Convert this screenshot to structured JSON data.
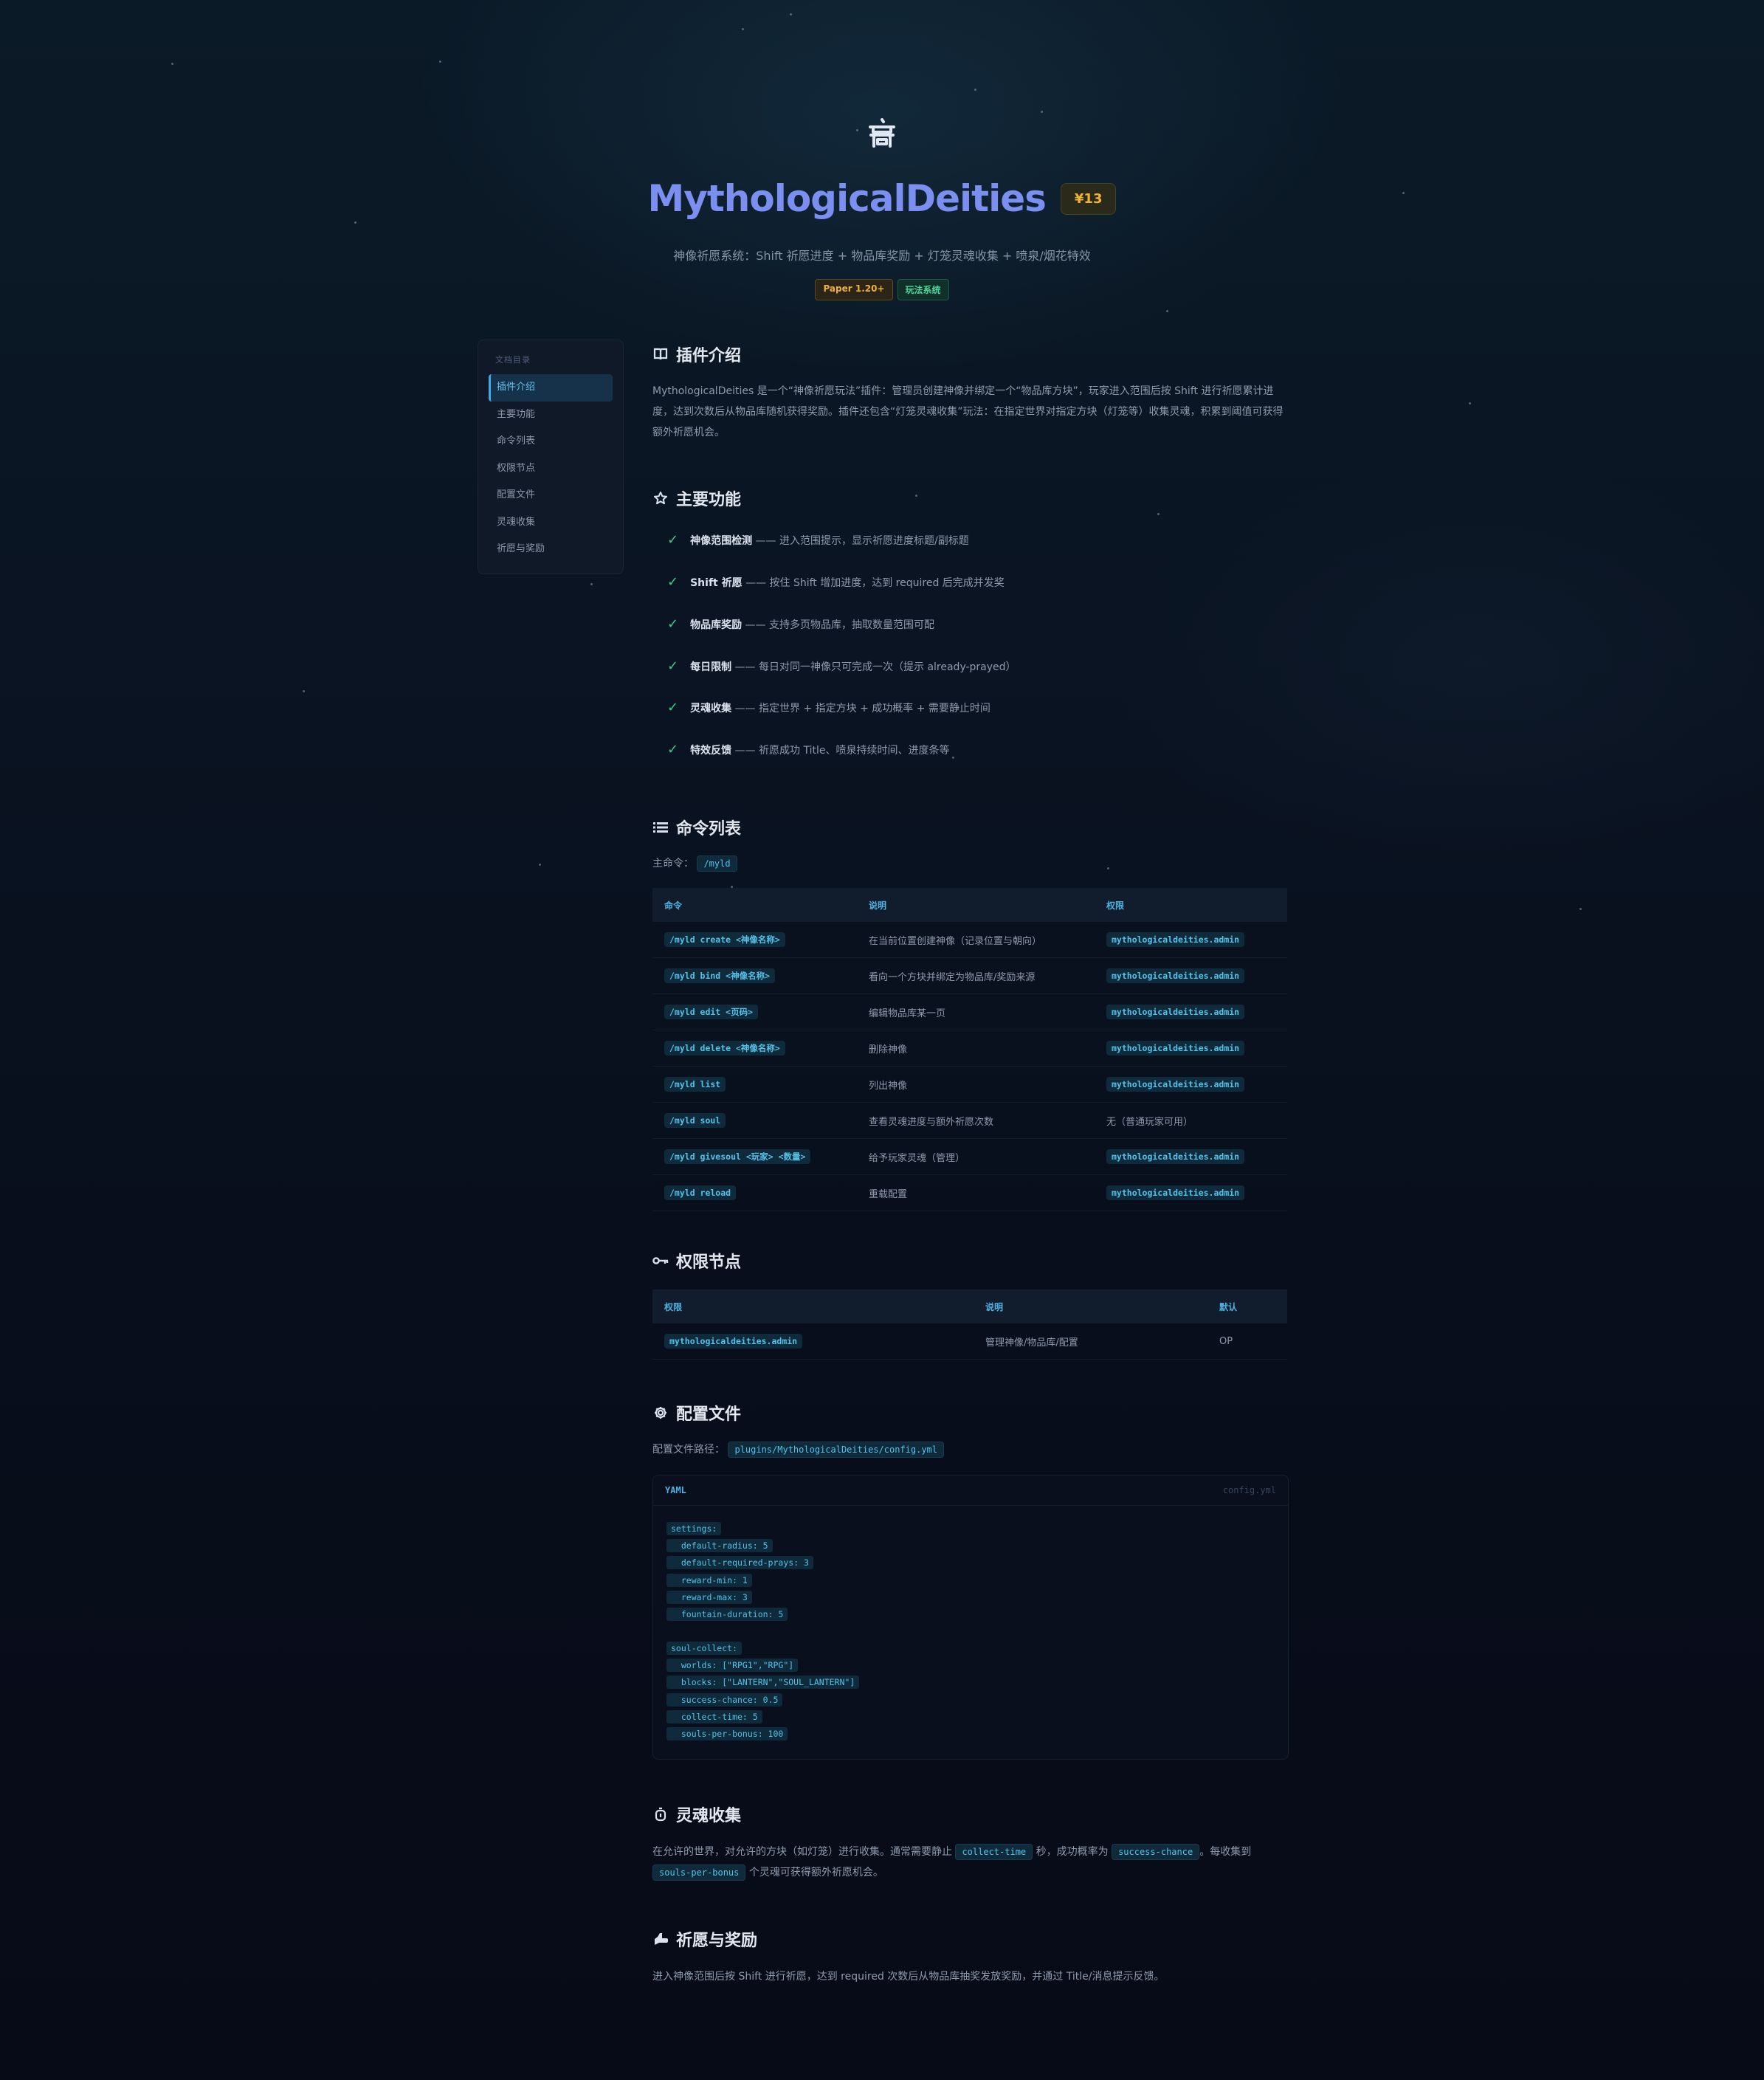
{
  "hero": {
    "icon": "temple-icon",
    "title": "MythologicalDeities",
    "price": "¥13",
    "subtitle": "神像祈愿系统：Shift 祈愿进度 + 物品库奖励 + 灯笼灵魂收集 + 喷泉/烟花特效",
    "tag_version": "Paper 1.20+",
    "tag_category": "玩法系统"
  },
  "toc": {
    "title": "文档目录",
    "items": [
      "插件介绍",
      "主要功能",
      "命令列表",
      "权限节点",
      "配置文件",
      "灵魂收集",
      "祈愿与奖励"
    ]
  },
  "intro": {
    "heading": "插件介绍",
    "text": "MythologicalDeities 是一个“神像祈愿玩法”插件：管理员创建神像并绑定一个“物品库方块”，玩家进入范围后按 Shift 进行祈愿累计进度，达到次数后从物品库随机获得奖励。插件还包含“灯笼灵魂收集”玩法：在指定世界对指定方块（灯笼等）收集灵魂，积累到阈值可获得额外祈愿机会。"
  },
  "features": {
    "heading": "主要功能",
    "items": [
      {
        "name": "神像范围检测",
        "desc": "—— 进入范围提示，显示祈愿进度标题/副标题"
      },
      {
        "name": "Shift 祈愿",
        "desc": "—— 按住 Shift 增加进度，达到 required 后完成并发奖"
      },
      {
        "name": "物品库奖励",
        "desc": "—— 支持多页物品库，抽取数量范围可配"
      },
      {
        "name": "每日限制",
        "desc": "—— 每日对同一神像只可完成一次（提示 already-prayed）"
      },
      {
        "name": "灵魂收集",
        "desc": "—— 指定世界 + 指定方块 + 成功概率 + 需要静止时间"
      },
      {
        "name": "特效反馈",
        "desc": "—— 祈愿成功 Title、喷泉持续时间、进度条等"
      }
    ]
  },
  "commands": {
    "heading": "命令列表",
    "main_label": "主命令：",
    "main_cmd": "/myld",
    "headers": [
      "命令",
      "说明",
      "权限"
    ],
    "rows": [
      {
        "cmd": "/myld create <神像名称>",
        "desc": "在当前位置创建神像（记录位置与朝向）",
        "perm": "mythologicaldeities.admin"
      },
      {
        "cmd": "/myld bind <神像名称>",
        "desc": "看向一个方块并绑定为物品库/奖励来源",
        "perm": "mythologicaldeities.admin"
      },
      {
        "cmd": "/myld edit <页码>",
        "desc": "编辑物品库某一页",
        "perm": "mythologicaldeities.admin"
      },
      {
        "cmd": "/myld delete <神像名称>",
        "desc": "删除神像",
        "perm": "mythologicaldeities.admin"
      },
      {
        "cmd": "/myld list",
        "desc": "列出神像",
        "perm": "mythologicaldeities.admin"
      },
      {
        "cmd": "/myld soul",
        "desc": "查看灵魂进度与额外祈愿次数",
        "perm": "无（普通玩家可用）"
      },
      {
        "cmd": "/myld givesoul <玩家> <数量>",
        "desc": "给予玩家灵魂（管理）",
        "perm": "mythologicaldeities.admin"
      },
      {
        "cmd": "/myld reload",
        "desc": "重载配置",
        "perm": "mythologicaldeities.admin"
      }
    ]
  },
  "permissions": {
    "heading": "权限节点",
    "headers": [
      "权限",
      "说明",
      "默认"
    ],
    "rows": [
      {
        "perm": "mythologicaldeities.admin",
        "desc": "管理神像/物品库/配置",
        "default": "OP"
      }
    ]
  },
  "config": {
    "heading": "配置文件",
    "path_label": "配置文件路径：",
    "path": "plugins/MythologicalDeities/config.yml",
    "lang": "YAML",
    "filename": "config.yml",
    "lines": [
      "settings:",
      "  default-radius: 5",
      "  default-required-prays: 3",
      "  reward-min: 1",
      "  reward-max: 3",
      "  fountain-duration: 5",
      "soul-collect:",
      "  worlds: [\"RPG1\",\"RPG\"]",
      "  blocks: [\"LANTERN\",\"SOUL_LANTERN\"]",
      "  success-chance: 0.5",
      "  collect-time: 5",
      "  souls-per-bonus: 100"
    ]
  },
  "soul": {
    "heading": "灵魂收集",
    "t1": "在允许的世界，对允许的方块（如灯笼）进行收集。通常需要静止",
    "c1": "collect-time",
    "t2": "秒，成功概率为",
    "c2": "success-chance",
    "t3": "。每收集到",
    "c3": "souls-per-bonus",
    "t4": "个灵魂可获得额外祈愿机会。"
  },
  "pray": {
    "heading": "祈愿与奖励",
    "text": "进入神像范围后按 Shift 进行祈愿，达到 required 次数后从物品库抽奖发放奖励，并通过 Title/消息提示反馈。"
  }
}
